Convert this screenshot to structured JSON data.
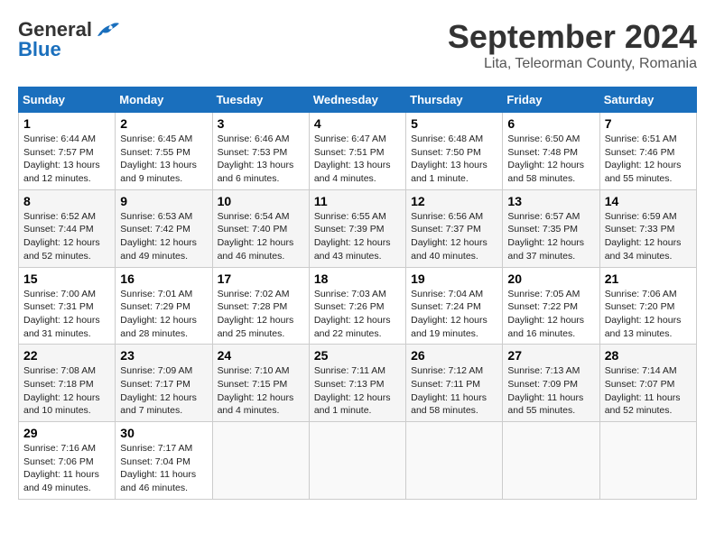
{
  "header": {
    "logo_general": "General",
    "logo_blue": "Blue",
    "month_year": "September 2024",
    "location": "Lita, Teleorman County, Romania"
  },
  "calendar": {
    "columns": [
      "Sunday",
      "Monday",
      "Tuesday",
      "Wednesday",
      "Thursday",
      "Friday",
      "Saturday"
    ],
    "weeks": [
      [
        {
          "day": "",
          "content": ""
        },
        {
          "day": "2",
          "content": "Sunrise: 6:45 AM\nSunset: 7:55 PM\nDaylight: 13 hours and 9 minutes."
        },
        {
          "day": "3",
          "content": "Sunrise: 6:46 AM\nSunset: 7:53 PM\nDaylight: 13 hours and 6 minutes."
        },
        {
          "day": "4",
          "content": "Sunrise: 6:47 AM\nSunset: 7:51 PM\nDaylight: 13 hours and 4 minutes."
        },
        {
          "day": "5",
          "content": "Sunrise: 6:48 AM\nSunset: 7:50 PM\nDaylight: 13 hours and 1 minute."
        },
        {
          "day": "6",
          "content": "Sunrise: 6:50 AM\nSunset: 7:48 PM\nDaylight: 12 hours and 58 minutes."
        },
        {
          "day": "7",
          "content": "Sunrise: 6:51 AM\nSunset: 7:46 PM\nDaylight: 12 hours and 55 minutes."
        }
      ],
      [
        {
          "day": "1",
          "content": "Sunrise: 6:44 AM\nSunset: 7:57 PM\nDaylight: 13 hours and 12 minutes."
        },
        {
          "day": "9",
          "content": "Sunrise: 6:53 AM\nSunset: 7:42 PM\nDaylight: 12 hours and 49 minutes."
        },
        {
          "day": "10",
          "content": "Sunrise: 6:54 AM\nSunset: 7:40 PM\nDaylight: 12 hours and 46 minutes."
        },
        {
          "day": "11",
          "content": "Sunrise: 6:55 AM\nSunset: 7:39 PM\nDaylight: 12 hours and 43 minutes."
        },
        {
          "day": "12",
          "content": "Sunrise: 6:56 AM\nSunset: 7:37 PM\nDaylight: 12 hours and 40 minutes."
        },
        {
          "day": "13",
          "content": "Sunrise: 6:57 AM\nSunset: 7:35 PM\nDaylight: 12 hours and 37 minutes."
        },
        {
          "day": "14",
          "content": "Sunrise: 6:59 AM\nSunset: 7:33 PM\nDaylight: 12 hours and 34 minutes."
        }
      ],
      [
        {
          "day": "8",
          "content": "Sunrise: 6:52 AM\nSunset: 7:44 PM\nDaylight: 12 hours and 52 minutes."
        },
        {
          "day": "16",
          "content": "Sunrise: 7:01 AM\nSunset: 7:29 PM\nDaylight: 12 hours and 28 minutes."
        },
        {
          "day": "17",
          "content": "Sunrise: 7:02 AM\nSunset: 7:28 PM\nDaylight: 12 hours and 25 minutes."
        },
        {
          "day": "18",
          "content": "Sunrise: 7:03 AM\nSunset: 7:26 PM\nDaylight: 12 hours and 22 minutes."
        },
        {
          "day": "19",
          "content": "Sunrise: 7:04 AM\nSunset: 7:24 PM\nDaylight: 12 hours and 19 minutes."
        },
        {
          "day": "20",
          "content": "Sunrise: 7:05 AM\nSunset: 7:22 PM\nDaylight: 12 hours and 16 minutes."
        },
        {
          "day": "21",
          "content": "Sunrise: 7:06 AM\nSunset: 7:20 PM\nDaylight: 12 hours and 13 minutes."
        }
      ],
      [
        {
          "day": "15",
          "content": "Sunrise: 7:00 AM\nSunset: 7:31 PM\nDaylight: 12 hours and 31 minutes."
        },
        {
          "day": "23",
          "content": "Sunrise: 7:09 AM\nSunset: 7:17 PM\nDaylight: 12 hours and 7 minutes."
        },
        {
          "day": "24",
          "content": "Sunrise: 7:10 AM\nSunset: 7:15 PM\nDaylight: 12 hours and 4 minutes."
        },
        {
          "day": "25",
          "content": "Sunrise: 7:11 AM\nSunset: 7:13 PM\nDaylight: 12 hours and 1 minute."
        },
        {
          "day": "26",
          "content": "Sunrise: 7:12 AM\nSunset: 7:11 PM\nDaylight: 11 hours and 58 minutes."
        },
        {
          "day": "27",
          "content": "Sunrise: 7:13 AM\nSunset: 7:09 PM\nDaylight: 11 hours and 55 minutes."
        },
        {
          "day": "28",
          "content": "Sunrise: 7:14 AM\nSunset: 7:07 PM\nDaylight: 11 hours and 52 minutes."
        }
      ],
      [
        {
          "day": "22",
          "content": "Sunrise: 7:08 AM\nSunset: 7:18 PM\nDaylight: 12 hours and 10 minutes."
        },
        {
          "day": "30",
          "content": "Sunrise: 7:17 AM\nSunset: 7:04 PM\nDaylight: 11 hours and 46 minutes."
        },
        {
          "day": "",
          "content": ""
        },
        {
          "day": "",
          "content": ""
        },
        {
          "day": "",
          "content": ""
        },
        {
          "day": "",
          "content": ""
        },
        {
          "day": "",
          "content": ""
        }
      ],
      [
        {
          "day": "29",
          "content": "Sunrise: 7:16 AM\nSunset: 7:06 PM\nDaylight: 11 hours and 49 minutes."
        },
        {
          "day": "",
          "content": ""
        },
        {
          "day": "",
          "content": ""
        },
        {
          "day": "",
          "content": ""
        },
        {
          "day": "",
          "content": ""
        },
        {
          "day": "",
          "content": ""
        },
        {
          "day": "",
          "content": ""
        }
      ]
    ]
  }
}
